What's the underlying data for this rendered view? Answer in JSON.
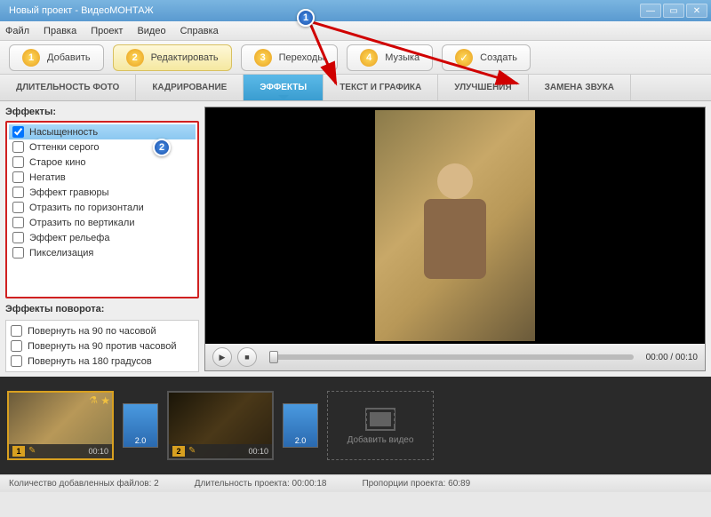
{
  "window": {
    "title": "Новый проект - ВидеоМОНТАЖ"
  },
  "menu": [
    "Файл",
    "Правка",
    "Проект",
    "Видео",
    "Справка"
  ],
  "steps": [
    {
      "num": "1",
      "label": "Добавить"
    },
    {
      "num": "2",
      "label": "Редактировать"
    },
    {
      "num": "3",
      "label": "Переходы"
    },
    {
      "num": "4",
      "label": "Музыка"
    },
    {
      "check": "✓",
      "label": "Создать"
    }
  ],
  "subtabs": [
    "ДЛИТЕЛЬНОСТЬ ФОТО",
    "КАДРИРОВАНИЕ",
    "ЭФФЕКТЫ",
    "ТЕКСТ И ГРАФИКА",
    "УЛУЧШЕНИЯ",
    "ЗАМЕНА ЗВУКА"
  ],
  "effects": {
    "title": "Эффекты:",
    "items": [
      "Насыщенность",
      "Оттенки серого",
      "Старое кино",
      "Негатив",
      "Эффект гравюры",
      "Отразить по горизонтали",
      "Отразить по вертикали",
      "Эффект рельефа",
      "Пикселизация"
    ],
    "rotate_title": "Эффекты поворота:",
    "rotate_items": [
      "Повернуть на 90 по часовой",
      "Повернуть на 90 против часовой",
      "Повернуть на 180 градусов"
    ]
  },
  "player": {
    "time": "00:00 / 00:10"
  },
  "timeline": {
    "clips": [
      {
        "num": "1",
        "time": "00:10"
      },
      {
        "num": "2",
        "time": "00:10"
      }
    ],
    "transition": "2.0",
    "add_label": "Добавить видео"
  },
  "status": {
    "files": "Количество добавленных файлов: 2",
    "duration": "Длительность проекта:   00:00:18",
    "aspect": "Пропорции проекта:   60:89"
  },
  "annotations": {
    "b1": "1",
    "b2": "2"
  }
}
